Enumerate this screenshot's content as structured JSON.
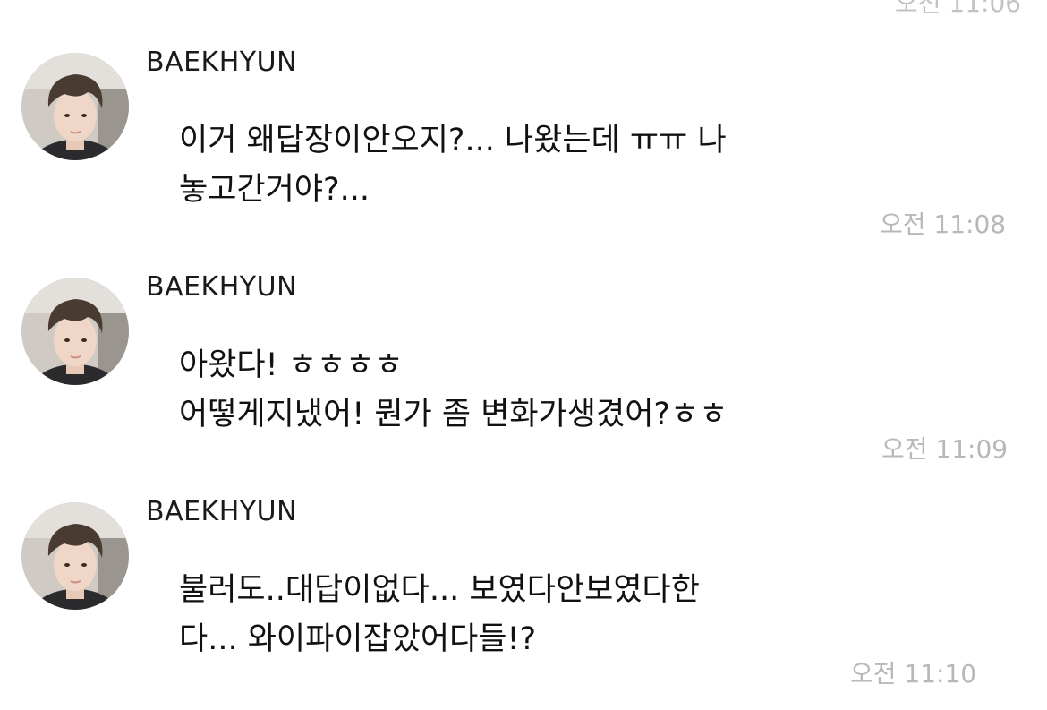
{
  "top_partial_time": "오전 11:06",
  "messages": [
    {
      "sender": "BAEKHYUN",
      "lines": [
        "이거 왜답장이안오지?... 나왔는데 ㅠㅠ 나",
        "놓고간거야?..."
      ],
      "time": "오전 11:08"
    },
    {
      "sender": "BAEKHYUN",
      "lines": [
        "아왔다! ㅎㅎㅎㅎ",
        "어떻게지냈어! 뭔가 좀 변화가생겼어?ㅎㅎ"
      ],
      "time": "오전 11:09"
    },
    {
      "sender": "BAEKHYUN",
      "lines": [
        "불러도..대답이없다... 보였다안보였다한",
        "다... 와이파이잡았어다들!?"
      ],
      "time": "오전 11:10"
    }
  ],
  "colors": {
    "background": "#ffffff",
    "sender_text": "#1a1a1a",
    "message_text": "#111111",
    "timestamp": "#b8b8b8"
  },
  "icons": {
    "avatar": "profile-photo-avatar"
  }
}
